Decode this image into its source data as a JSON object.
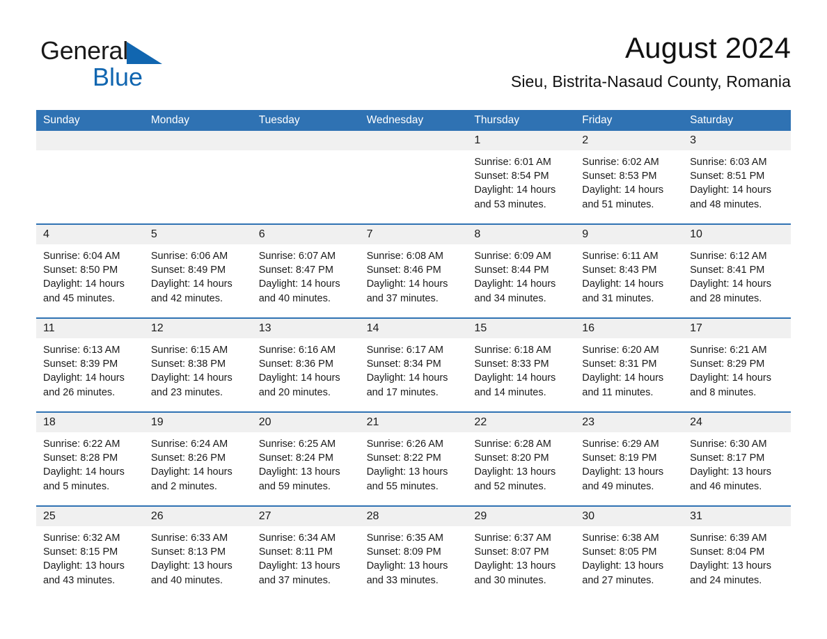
{
  "brand": {
    "name_part1": "General",
    "name_part2": "Blue",
    "triangle_icon": "blue-triangle-logo-mark",
    "accent_color": "#1166b0"
  },
  "header": {
    "title": "August 2024",
    "subtitle": "Sieu, Bistrita-Nasaud County, Romania"
  },
  "colors": {
    "header_blue": "#2f72b3",
    "daynum_band": "#f0f0f0",
    "text": "#1a1a1a"
  },
  "weekdays": [
    "Sunday",
    "Monday",
    "Tuesday",
    "Wednesday",
    "Thursday",
    "Friday",
    "Saturday"
  ],
  "weeks": [
    [
      {
        "day": "",
        "sunrise": "",
        "sunset": "",
        "daylight_line1": "",
        "daylight_line2": ""
      },
      {
        "day": "",
        "sunrise": "",
        "sunset": "",
        "daylight_line1": "",
        "daylight_line2": ""
      },
      {
        "day": "",
        "sunrise": "",
        "sunset": "",
        "daylight_line1": "",
        "daylight_line2": ""
      },
      {
        "day": "",
        "sunrise": "",
        "sunset": "",
        "daylight_line1": "",
        "daylight_line2": ""
      },
      {
        "day": "1",
        "sunrise": "Sunrise: 6:01 AM",
        "sunset": "Sunset: 8:54 PM",
        "daylight_line1": "Daylight: 14 hours",
        "daylight_line2": "and 53 minutes."
      },
      {
        "day": "2",
        "sunrise": "Sunrise: 6:02 AM",
        "sunset": "Sunset: 8:53 PM",
        "daylight_line1": "Daylight: 14 hours",
        "daylight_line2": "and 51 minutes."
      },
      {
        "day": "3",
        "sunrise": "Sunrise: 6:03 AM",
        "sunset": "Sunset: 8:51 PM",
        "daylight_line1": "Daylight: 14 hours",
        "daylight_line2": "and 48 minutes."
      }
    ],
    [
      {
        "day": "4",
        "sunrise": "Sunrise: 6:04 AM",
        "sunset": "Sunset: 8:50 PM",
        "daylight_line1": "Daylight: 14 hours",
        "daylight_line2": "and 45 minutes."
      },
      {
        "day": "5",
        "sunrise": "Sunrise: 6:06 AM",
        "sunset": "Sunset: 8:49 PM",
        "daylight_line1": "Daylight: 14 hours",
        "daylight_line2": "and 42 minutes."
      },
      {
        "day": "6",
        "sunrise": "Sunrise: 6:07 AM",
        "sunset": "Sunset: 8:47 PM",
        "daylight_line1": "Daylight: 14 hours",
        "daylight_line2": "and 40 minutes."
      },
      {
        "day": "7",
        "sunrise": "Sunrise: 6:08 AM",
        "sunset": "Sunset: 8:46 PM",
        "daylight_line1": "Daylight: 14 hours",
        "daylight_line2": "and 37 minutes."
      },
      {
        "day": "8",
        "sunrise": "Sunrise: 6:09 AM",
        "sunset": "Sunset: 8:44 PM",
        "daylight_line1": "Daylight: 14 hours",
        "daylight_line2": "and 34 minutes."
      },
      {
        "day": "9",
        "sunrise": "Sunrise: 6:11 AM",
        "sunset": "Sunset: 8:43 PM",
        "daylight_line1": "Daylight: 14 hours",
        "daylight_line2": "and 31 minutes."
      },
      {
        "day": "10",
        "sunrise": "Sunrise: 6:12 AM",
        "sunset": "Sunset: 8:41 PM",
        "daylight_line1": "Daylight: 14 hours",
        "daylight_line2": "and 28 minutes."
      }
    ],
    [
      {
        "day": "11",
        "sunrise": "Sunrise: 6:13 AM",
        "sunset": "Sunset: 8:39 PM",
        "daylight_line1": "Daylight: 14 hours",
        "daylight_line2": "and 26 minutes."
      },
      {
        "day": "12",
        "sunrise": "Sunrise: 6:15 AM",
        "sunset": "Sunset: 8:38 PM",
        "daylight_line1": "Daylight: 14 hours",
        "daylight_line2": "and 23 minutes."
      },
      {
        "day": "13",
        "sunrise": "Sunrise: 6:16 AM",
        "sunset": "Sunset: 8:36 PM",
        "daylight_line1": "Daylight: 14 hours",
        "daylight_line2": "and 20 minutes."
      },
      {
        "day": "14",
        "sunrise": "Sunrise: 6:17 AM",
        "sunset": "Sunset: 8:34 PM",
        "daylight_line1": "Daylight: 14 hours",
        "daylight_line2": "and 17 minutes."
      },
      {
        "day": "15",
        "sunrise": "Sunrise: 6:18 AM",
        "sunset": "Sunset: 8:33 PM",
        "daylight_line1": "Daylight: 14 hours",
        "daylight_line2": "and 14 minutes."
      },
      {
        "day": "16",
        "sunrise": "Sunrise: 6:20 AM",
        "sunset": "Sunset: 8:31 PM",
        "daylight_line1": "Daylight: 14 hours",
        "daylight_line2": "and 11 minutes."
      },
      {
        "day": "17",
        "sunrise": "Sunrise: 6:21 AM",
        "sunset": "Sunset: 8:29 PM",
        "daylight_line1": "Daylight: 14 hours",
        "daylight_line2": "and 8 minutes."
      }
    ],
    [
      {
        "day": "18",
        "sunrise": "Sunrise: 6:22 AM",
        "sunset": "Sunset: 8:28 PM",
        "daylight_line1": "Daylight: 14 hours",
        "daylight_line2": "and 5 minutes."
      },
      {
        "day": "19",
        "sunrise": "Sunrise: 6:24 AM",
        "sunset": "Sunset: 8:26 PM",
        "daylight_line1": "Daylight: 14 hours",
        "daylight_line2": "and 2 minutes."
      },
      {
        "day": "20",
        "sunrise": "Sunrise: 6:25 AM",
        "sunset": "Sunset: 8:24 PM",
        "daylight_line1": "Daylight: 13 hours",
        "daylight_line2": "and 59 minutes."
      },
      {
        "day": "21",
        "sunrise": "Sunrise: 6:26 AM",
        "sunset": "Sunset: 8:22 PM",
        "daylight_line1": "Daylight: 13 hours",
        "daylight_line2": "and 55 minutes."
      },
      {
        "day": "22",
        "sunrise": "Sunrise: 6:28 AM",
        "sunset": "Sunset: 8:20 PM",
        "daylight_line1": "Daylight: 13 hours",
        "daylight_line2": "and 52 minutes."
      },
      {
        "day": "23",
        "sunrise": "Sunrise: 6:29 AM",
        "sunset": "Sunset: 8:19 PM",
        "daylight_line1": "Daylight: 13 hours",
        "daylight_line2": "and 49 minutes."
      },
      {
        "day": "24",
        "sunrise": "Sunrise: 6:30 AM",
        "sunset": "Sunset: 8:17 PM",
        "daylight_line1": "Daylight: 13 hours",
        "daylight_line2": "and 46 minutes."
      }
    ],
    [
      {
        "day": "25",
        "sunrise": "Sunrise: 6:32 AM",
        "sunset": "Sunset: 8:15 PM",
        "daylight_line1": "Daylight: 13 hours",
        "daylight_line2": "and 43 minutes."
      },
      {
        "day": "26",
        "sunrise": "Sunrise: 6:33 AM",
        "sunset": "Sunset: 8:13 PM",
        "daylight_line1": "Daylight: 13 hours",
        "daylight_line2": "and 40 minutes."
      },
      {
        "day": "27",
        "sunrise": "Sunrise: 6:34 AM",
        "sunset": "Sunset: 8:11 PM",
        "daylight_line1": "Daylight: 13 hours",
        "daylight_line2": "and 37 minutes."
      },
      {
        "day": "28",
        "sunrise": "Sunrise: 6:35 AM",
        "sunset": "Sunset: 8:09 PM",
        "daylight_line1": "Daylight: 13 hours",
        "daylight_line2": "and 33 minutes."
      },
      {
        "day": "29",
        "sunrise": "Sunrise: 6:37 AM",
        "sunset": "Sunset: 8:07 PM",
        "daylight_line1": "Daylight: 13 hours",
        "daylight_line2": "and 30 minutes."
      },
      {
        "day": "30",
        "sunrise": "Sunrise: 6:38 AM",
        "sunset": "Sunset: 8:05 PM",
        "daylight_line1": "Daylight: 13 hours",
        "daylight_line2": "and 27 minutes."
      },
      {
        "day": "31",
        "sunrise": "Sunrise: 6:39 AM",
        "sunset": "Sunset: 8:04 PM",
        "daylight_line1": "Daylight: 13 hours",
        "daylight_line2": "and 24 minutes."
      }
    ]
  ]
}
